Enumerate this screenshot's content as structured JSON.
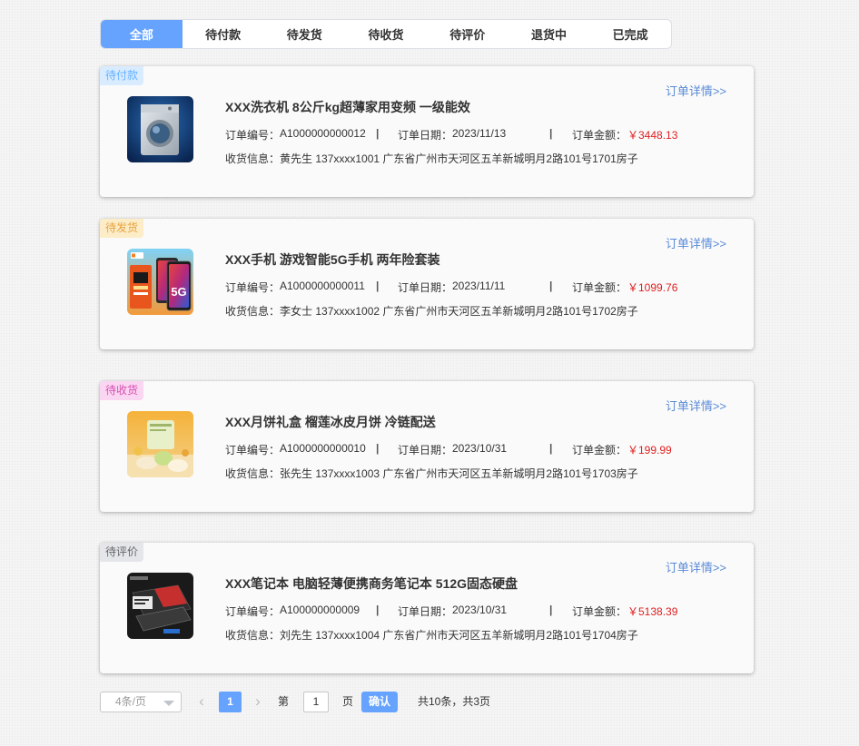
{
  "tabs": [
    "全部",
    "待付款",
    "待发货",
    "待收货",
    "待评价",
    "退货中",
    "已完成"
  ],
  "labels": {
    "detail": "订单详情>>",
    "order_no": "订单编号：",
    "order_date": "订单日期：",
    "order_amount": "订单金额：",
    "receiver": "收货信息：",
    "separator": "|"
  },
  "orders": [
    {
      "status": "待付款",
      "title": "XXX洗衣机 8公斤kg超薄家用变频 一级能效",
      "order_no": "A1000000000012",
      "date": "2023/11/13",
      "amount": "￥3448.13",
      "receiver": "黄先生 137xxxx1001 广东省广州市天河区五羊新城明月2路101号1701房子",
      "image": "washing-machine"
    },
    {
      "status": "待发货",
      "title": "XXX手机 游戏智能5G手机 两年险套装",
      "order_no": "A1000000000011",
      "date": "2023/11/11",
      "amount": "￥1099.76",
      "receiver": "李女士 137xxxx1002 广东省广州市天河区五羊新城明月2路101号1702房子",
      "image": "smartphone",
      "image_text": "5G"
    },
    {
      "status": "待收货",
      "title": "XXX月饼礼盒 榴莲冰皮月饼 冷链配送",
      "order_no": "A1000000000010",
      "date": "2023/10/31",
      "amount": "￥199.99",
      "receiver": "张先生 137xxxx1003 广东省广州市天河区五羊新城明月2路101号1703房子",
      "image": "mooncake"
    },
    {
      "status": "待评价",
      "title": "XXX笔记本 电脑轻薄便携商务笔记本 512G固态硬盘",
      "order_no": "A100000000009",
      "date": "2023/10/31",
      "amount": "￥5138.39",
      "receiver": "刘先生 137xxxx1004 广东省广州市天河区五羊新城明月2路101号1704房子",
      "image": "laptop"
    }
  ],
  "pagination": {
    "page_size": "4条/页",
    "current_page": "1",
    "go_prefix": "第",
    "go_value": "1",
    "go_suffix": "页",
    "confirm": "确认",
    "summary": "共10条，共3页",
    "prev_icon": "‹",
    "next_icon": "›"
  },
  "colors": {
    "accent": "#66a3ff",
    "price": "#e02020",
    "link": "#5a8bd8"
  }
}
